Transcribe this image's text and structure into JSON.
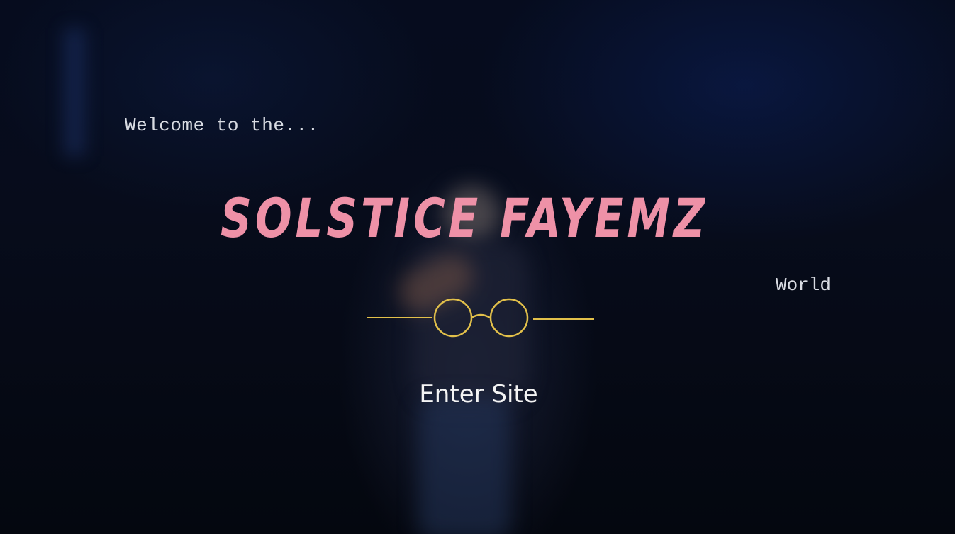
{
  "hero": {
    "welcome_text": "Welcome to the...",
    "brand_title": "SOLSTICE FAYEMZ",
    "world_text": "World",
    "enter_label": "Enter Site"
  },
  "colors": {
    "brand": "#ee91a7",
    "accent_gold": "#e2c04a",
    "text_light": "#d8dbe2",
    "background": "#04060d"
  },
  "icons": {
    "divider": "glasses-icon"
  }
}
